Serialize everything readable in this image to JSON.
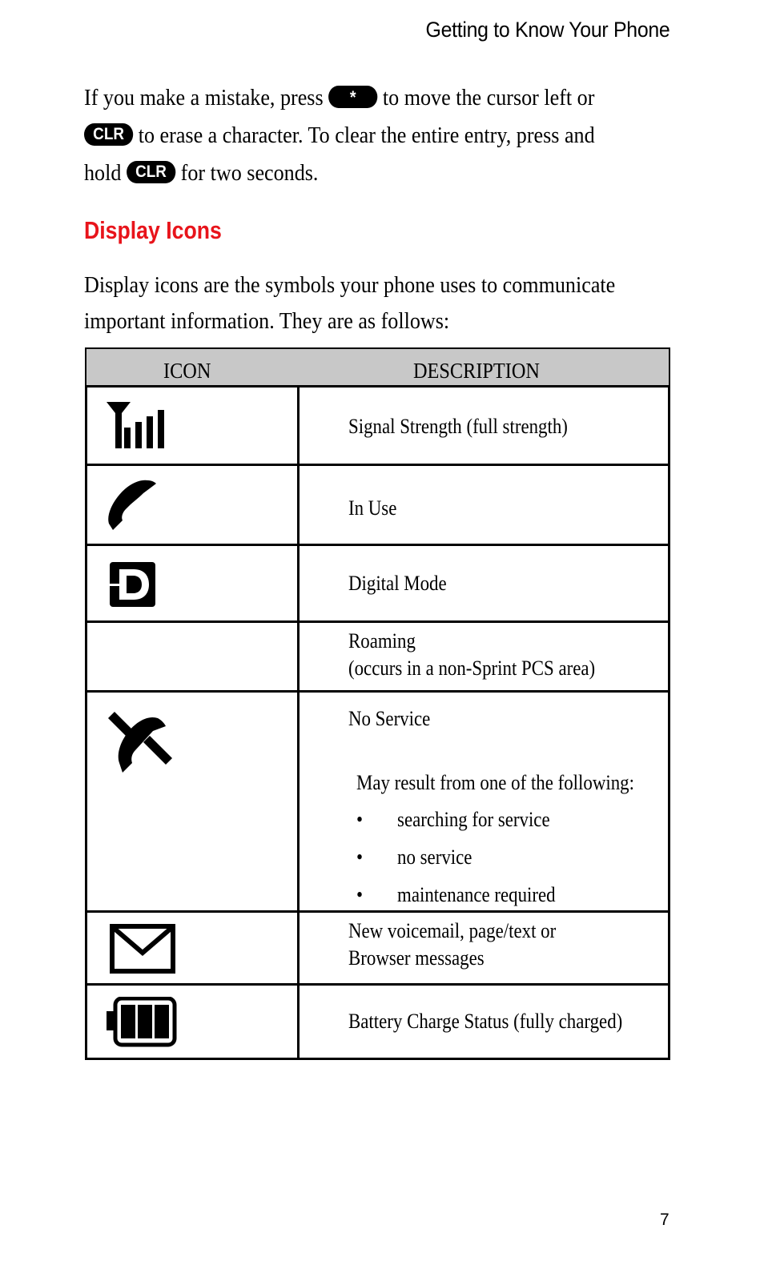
{
  "running_head": "Getting to Know Your Phone",
  "intro": {
    "part1": "If you make a mistake, press ",
    "key_star": "*",
    "part2": " to move the cursor left or",
    "key_clr_1": "CLR",
    "part3": " to erase a character. To clear the entire entry, press and",
    "part4": "hold ",
    "key_clr_2": "CLR",
    "part5": " for two seconds."
  },
  "section": {
    "title": "Display Icons",
    "body_line1": "Display icons are the symbols your phone uses to communicate",
    "body_line2": "important information. They are as follows:"
  },
  "table": {
    "headers": {
      "icon": "ICON",
      "description": "DESCRIPTION"
    },
    "rows": [
      {
        "icon": "signal-strength-icon",
        "description": "Signal Strength (full strength)"
      },
      {
        "icon": "in-use-phone-icon",
        "description": "In Use"
      },
      {
        "icon": "digital-mode-icon",
        "description": "Digital Mode"
      },
      {
        "icon": "",
        "line1": "Roaming",
        "line2": "(occurs in a non-Sprint PCS area)"
      },
      {
        "icon": "no-service-icon",
        "description": "No Service",
        "note": "May result from one of the following:",
        "bullets": [
          "searching for service",
          "no service",
          "maintenance required"
        ],
        "bullet_glyph": "•"
      },
      {
        "icon": "envelope-icon",
        "line1": "New voicemail, page/text or",
        "line2": "Browser messages"
      },
      {
        "icon": "battery-full-icon",
        "description": "Battery Charge Status (fully charged)"
      }
    ]
  },
  "page_number": "7"
}
